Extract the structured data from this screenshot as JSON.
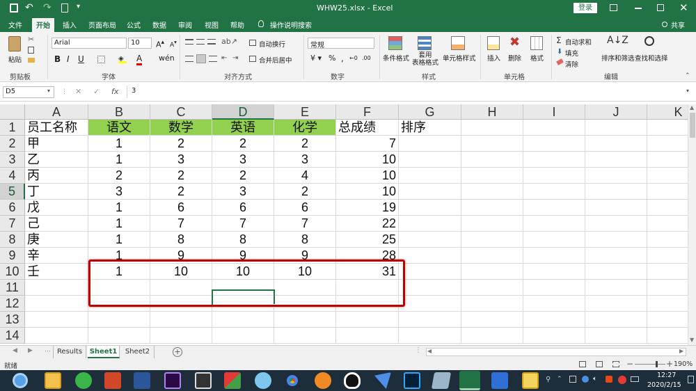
{
  "title": {
    "text": "WHW25.xlsx  -  Excel",
    "login": "登录"
  },
  "tabs": [
    "文件",
    "开始",
    "插入",
    "页面布局",
    "公式",
    "数据",
    "审阅",
    "视图",
    "帮助",
    "操作说明搜索"
  ],
  "share": "共享",
  "ribbon": {
    "clipboard": {
      "paste": "粘贴",
      "label": "剪贴板"
    },
    "font": {
      "name": "Arial",
      "size": "10",
      "label": "字体"
    },
    "align": {
      "wrap": "自动换行",
      "merge": "合并后居中",
      "label": "对齐方式"
    },
    "number": {
      "format": "常规",
      "label": "数字"
    },
    "styles": {
      "cond": "条件格式",
      "table": "套用\n表格格式",
      "cell": "单元格样式",
      "label": "样式"
    },
    "cells": {
      "insert": "插入",
      "delete": "删除",
      "format": "格式",
      "label": "单元格"
    },
    "editing": {
      "autosum": "自动求和",
      "fill": "填充",
      "clear": "清除",
      "sort": "排序和筛选",
      "find": "查找和选择",
      "label": "编辑"
    }
  },
  "formula": {
    "namebox": "D5",
    "value": "3",
    "fx": "fx"
  },
  "columns": [
    "A",
    "B",
    "C",
    "D",
    "E",
    "F",
    "G",
    "H",
    "I",
    "J",
    "K"
  ],
  "rows": [
    "1",
    "2",
    "3",
    "4",
    "5",
    "6",
    "7",
    "8",
    "9",
    "10",
    "11",
    "12",
    "13",
    "14"
  ],
  "sheet": {
    "headers": [
      "员工名称",
      "语文",
      "数学",
      "英语",
      "化学",
      "总成绩",
      "排序"
    ],
    "data": [
      [
        "甲",
        "1",
        "2",
        "2",
        "2",
        "7"
      ],
      [
        "乙",
        "1",
        "3",
        "3",
        "3",
        "10"
      ],
      [
        "丙",
        "2",
        "2",
        "2",
        "4",
        "10"
      ],
      [
        "丁",
        "3",
        "2",
        "3",
        "2",
        "10"
      ],
      [
        "戊",
        "1",
        "6",
        "6",
        "6",
        "19"
      ],
      [
        "己",
        "1",
        "7",
        "7",
        "7",
        "22"
      ],
      [
        "庚",
        "1",
        "8",
        "8",
        "8",
        "25"
      ],
      [
        "辛",
        "1",
        "9",
        "9",
        "9",
        "28"
      ],
      [
        "壬",
        "1",
        "10",
        "10",
        "10",
        "31"
      ]
    ]
  },
  "sheet_tabs": [
    "Results",
    "Sheet1",
    "Sheet2"
  ],
  "status": {
    "ready": "就绪",
    "zoom": "190%"
  },
  "clock": {
    "time": "12:27",
    "date": "2020/2/15"
  },
  "colors": {
    "excel_green": "#217346",
    "header_fill": "#92d050",
    "highlight": "#c00000"
  }
}
